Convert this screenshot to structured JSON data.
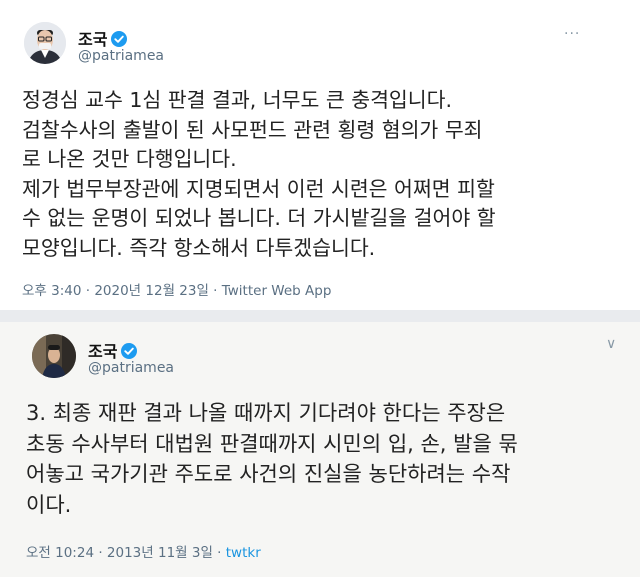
{
  "tweet1": {
    "name": "조국",
    "handle": "@patriamea",
    "text": "정경심 교수 1심 판결 결과, 너무도 큰 충격입니다.\n검찰수사의 출발이 된 사모펀드 관련 횡령 혐의가 무죄\n로 나온 것만 다행입니다.\n제가 법무부장관에 지명되면서 이런 시련은 어쩌면 피할\n수 없는 운명이 되었나 봅니다. 더 가시밭길을 걸어야 할\n모양입니다. 즉각 항소해서 다투겠습니다.",
    "meta": "오후 3:40 · 2020년 12월 23일 · Twitter Web App",
    "more": "···"
  },
  "tweet2": {
    "name": "조국",
    "handle": "@patriamea",
    "text": "3. 최종 재판 결과 나올 때까지 기다려야 한다는 주장은\n초동 수사부터 대법원 판결때까지 시민의 입, 손, 발을 묶\n어놓고 국가기관 주도로 사건의 진실을 농단하려는 수작\n이다.",
    "meta_prefix": "오전 10:24 · 2013년 11월 3일 · ",
    "meta_link": "twtkr",
    "more": "∨"
  },
  "colors": {
    "verified": "#1d9bf0",
    "link": "#1b95e0",
    "secondary_text": "#5b7083"
  },
  "icons": [
    "verified-badge-icon",
    "more-options-icon",
    "chevron-down-icon"
  ]
}
